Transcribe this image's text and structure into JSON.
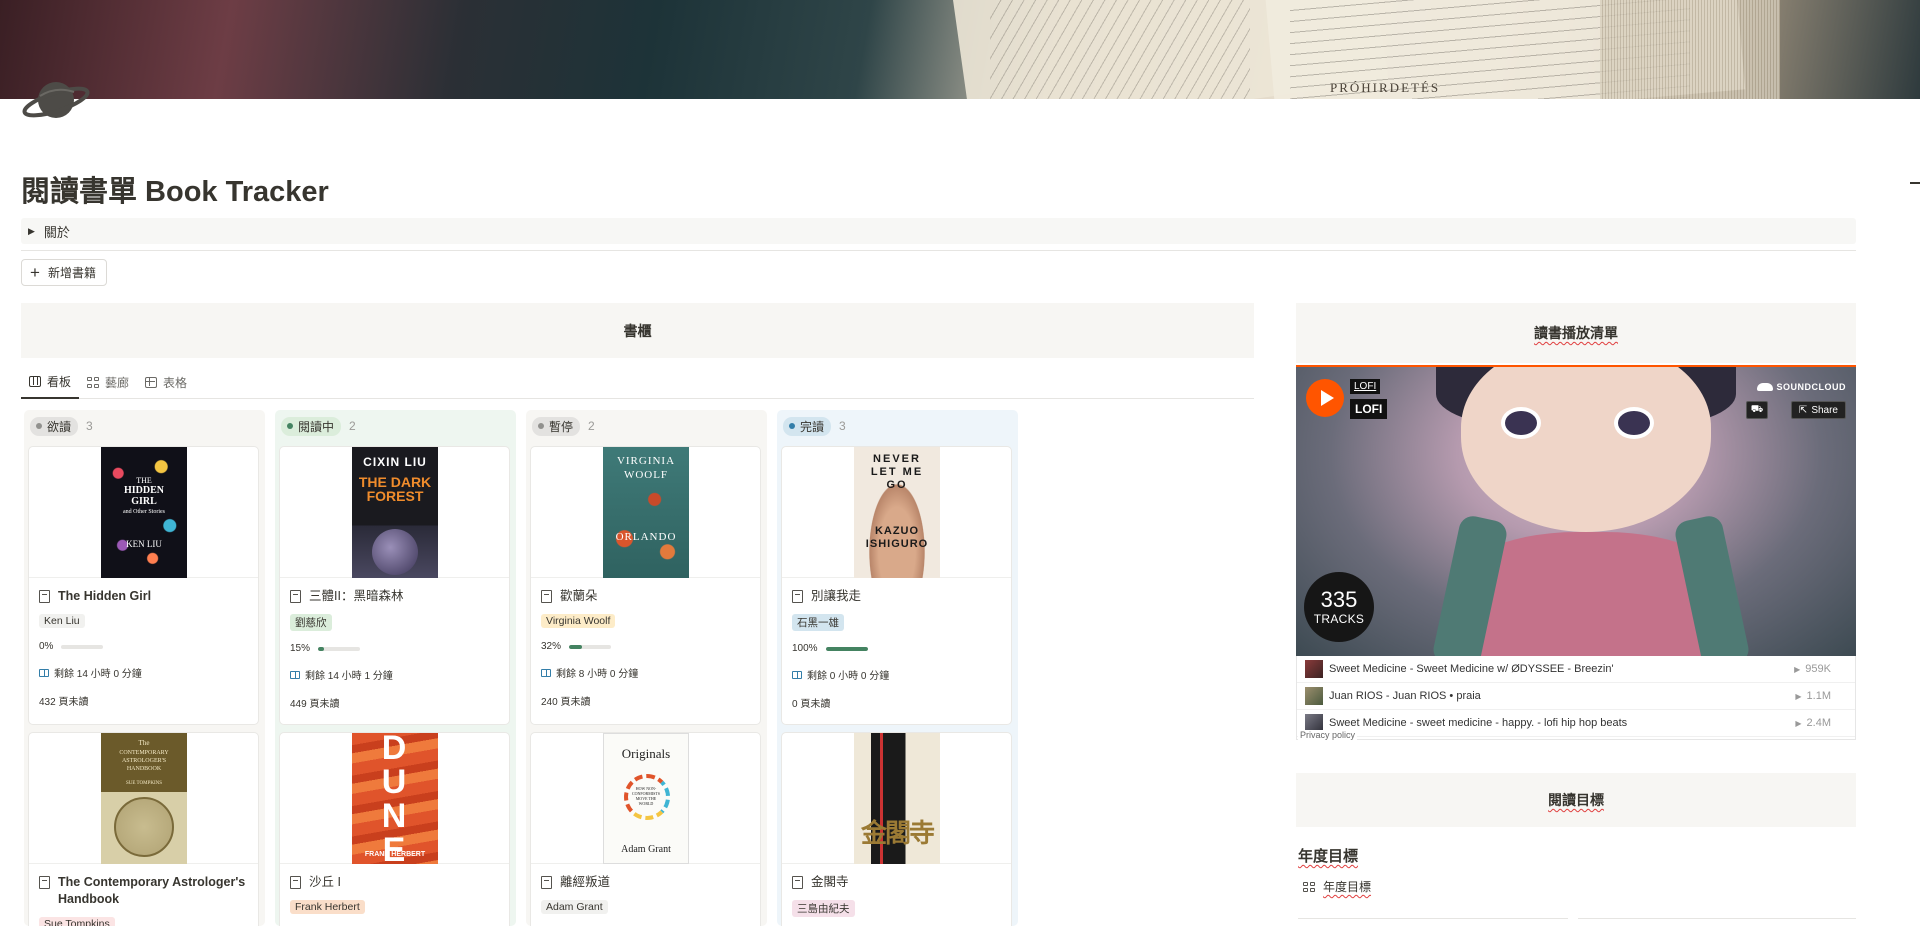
{
  "page": {
    "title": "閱讀書單 Book Tracker",
    "toggle_label": "關於",
    "add_book_label": "新增書籍",
    "cover_text": "PRÓHIRDETÉS"
  },
  "shelf": {
    "heading": "書櫃",
    "views": [
      {
        "label": "看板",
        "icon": "board-icon",
        "active": true
      },
      {
        "label": "藝廊",
        "icon": "gallery-icon",
        "active": false
      },
      {
        "label": "表格",
        "icon": "table-icon",
        "active": false
      }
    ],
    "groups": [
      {
        "status": "欲讀",
        "count": "3",
        "dot_color": "#91918e",
        "pill_bg": "#e3e2e0",
        "cards": [
          {
            "title": "The Hidden Girl",
            "author": "Ken Liu",
            "author_bg": "#f1f1ef",
            "progress": "0%",
            "progress_value": 0,
            "remaining_time": "剩餘 14 小時 0 分鐘",
            "pages_left": "432 頁未讀",
            "cover": {
              "line1": "THE",
              "line2": "HIDDEN GIRL",
              "line3": "and Other Stories",
              "line4": "KEN LIU"
            }
          },
          {
            "title": "The Contemporary Astrologer's Handbook",
            "author": "Sue Tompkins",
            "author_bg": "#fbe4e4",
            "cover": {
              "line1": "The",
              "line2": "CONTEMPORARY ASTROLOGER'S HANDBOOK",
              "line3": "",
              "line4": "SUE TOMPKINS"
            }
          }
        ]
      },
      {
        "status": "閱讀中",
        "count": "2",
        "dot_color": "#448361",
        "pill_bg": "#dbeddb",
        "cards": [
          {
            "title": "三體II：黑暗森林",
            "author": "劉慈欣",
            "author_bg": "#dbeddb",
            "progress": "15%",
            "progress_value": 15,
            "remaining_time": "剩餘 14 小時 1 分鐘",
            "pages_left": "449 頁未讀",
            "cover": {
              "line1": "CIXIN LIU",
              "line2": "THE DARK FOREST",
              "line3": "",
              "line4": ""
            }
          },
          {
            "title": "沙丘 I",
            "author": "Frank Herbert",
            "author_bg": "#fadec9",
            "cover": {
              "line1": "DUNE",
              "line2": "",
              "line3": "",
              "line4": "FRANK HERBERT"
            }
          }
        ]
      },
      {
        "status": "暫停",
        "count": "2",
        "dot_color": "#9f6b53",
        "pill_bg": "#e3e2e0",
        "cards": [
          {
            "title": "歡蘭朵",
            "author": "Virginia Woolf",
            "author_bg": "#fdecc8",
            "progress": "32%",
            "progress_value": 32,
            "remaining_time": "剩餘 8 小時 0 分鐘",
            "pages_left": "240 頁未讀",
            "cover": {
              "line1": "VIRGINIA",
              "line2": "WOOLF",
              "line3": "",
              "line4": "ORLANDO"
            }
          },
          {
            "title": "離經叛道",
            "author": "Adam Grant",
            "author_bg": "#f1f1ef",
            "cover": {
              "line1": "Originals",
              "line2": "HOW NON-CONFORMISTS MOVE THE WORLD",
              "line3": "",
              "line4": "Adam Grant"
            }
          }
        ]
      },
      {
        "status": "完讀",
        "count": "3",
        "dot_color": "#337ea9",
        "pill_bg": "#d3e5ef",
        "cards": [
          {
            "title": "別讓我走",
            "author": "石黑一雄",
            "author_bg": "#d3e5ef",
            "progress": "100%",
            "progress_value": 100,
            "remaining_time": "剩餘 0 小時 0 分鐘",
            "pages_left": "0 頁未讀",
            "cover": {
              "line1": "NEVER LET ME GO",
              "line2": "",
              "line3": "",
              "line4": "KAZUO ISHIGURO"
            }
          },
          {
            "title": "金閣寺",
            "author": "三島由紀夫",
            "author_bg": "#f5e0e9",
            "cover": {
              "line1": "金閣寺",
              "line2": "",
              "line3": "",
              "line4": ""
            }
          }
        ]
      }
    ]
  },
  "playlist": {
    "heading": "讀書播放清單",
    "uploader": "LOFI",
    "title": "LOFI",
    "brand": "SOUNDCLOUD",
    "share_label": "Share",
    "tracks_count": "335",
    "tracks_label": "TRACKS",
    "tracks": [
      {
        "name": "Sweet Medicine - Sweet Medicine w/ ØDYSSEE - Breezin'",
        "plays": "959K"
      },
      {
        "name": "Juan RIOS - Juan RIOS • praia",
        "plays": "1.1M"
      },
      {
        "name": "Sweet Medicine - sweet medicine - happy. - lofi hip hop beats",
        "plays": "2.4M"
      }
    ],
    "privacy": "Privacy policy"
  },
  "goals": {
    "heading": "閱讀目標",
    "subheading": "年度目標",
    "view_label": "年度目標"
  }
}
